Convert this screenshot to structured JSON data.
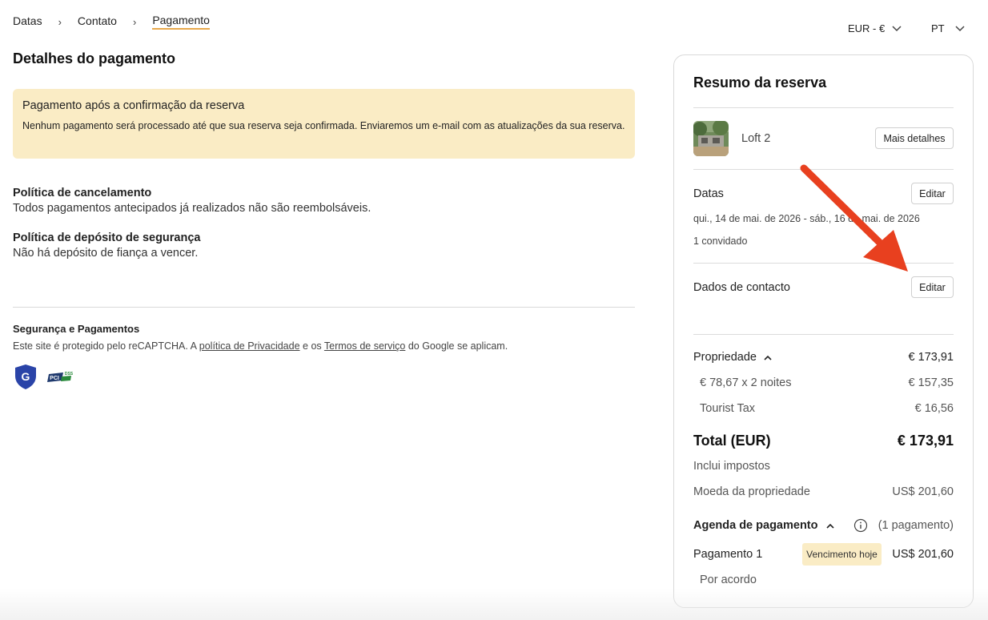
{
  "breadcrumb": {
    "items": [
      "Datas",
      "Contato",
      "Pagamento"
    ]
  },
  "currency_select": {
    "value": "EUR - €"
  },
  "language_select": {
    "value": "PT"
  },
  "page_title": "Detalhes do pagamento",
  "notice": {
    "title": "Pagamento após a confirmação da reserva",
    "text": "Nenhum pagamento será processado até que sua reserva seja confirmada. Enviaremos um e-mail com as atualizações da sua reserva."
  },
  "cancellation": {
    "title": "Política de cancelamento",
    "text": "Todos pagamentos antecipados já realizados não são reembolsáveis."
  },
  "deposit": {
    "title": "Política de depósito de segurança",
    "text": "Não há depósito de fiança a vencer."
  },
  "security": {
    "title": "Segurança e Pagamentos",
    "text_before": "Este site é protegido pelo reCAPTCHA. A ",
    "privacy_link": "política de Privacidade",
    "text_middle": " e os ",
    "terms_link": "Termos de serviço",
    "text_after": " do Google se aplicam.",
    "pci_badge_text": "PCI DSS"
  },
  "summary": {
    "title": "Resumo da reserva",
    "property_name": "Loft 2",
    "more_details_label": "Mais detalhes",
    "dates_label": "Datas",
    "edit_label": "Editar",
    "date_range": "qui., 14 de mai. de 2026 - sáb., 16 de mai. de 2026",
    "guests": "1 convidado",
    "contact_label": "Dados de contacto",
    "property_label": "Propriedade",
    "property_amount": "€ 173,91",
    "nights_label": "€ 78,67 x 2 noites",
    "nights_amount": "€ 157,35",
    "tax_label": "Tourist Tax",
    "tax_amount": "€ 16,56",
    "total_label": "Total (EUR)",
    "total_amount": "€ 173,91",
    "includes_taxes": "Inclui impostos",
    "property_currency_label": "Moeda da propriedade",
    "property_currency_amount": "US$ 201,60",
    "schedule_label": "Agenda de pagamento",
    "schedule_count": "(1 pagamento)",
    "payment1_label": "Pagamento 1",
    "payment1_badge": "Vencimento hoje",
    "payment1_amount": "US$ 201,60",
    "payment1_note": "Por acordo"
  },
  "colors": {
    "accent": "#e8a84b",
    "notice_bg": "#faecc5",
    "arrow": "#e8401f",
    "shield": "#2a44a8"
  }
}
